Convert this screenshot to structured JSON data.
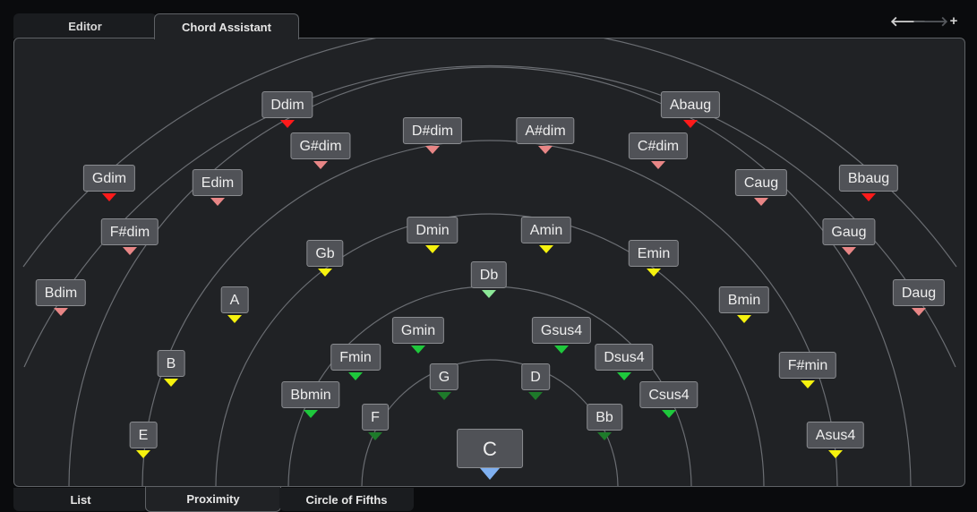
{
  "tabs_top": [
    {
      "label": "Editor",
      "active": false
    },
    {
      "label": "Chord Assistant",
      "active": true
    }
  ],
  "nav": {
    "back": "🡐",
    "forward": "🡒",
    "add": "+"
  },
  "colors": {
    "red": "#ff1a1a",
    "pink": "#e88686",
    "yellow": "#f6f20e",
    "green": "#1ec83c",
    "dark_green": "#1e7a2a",
    "light_green": "#8ce898",
    "blue": "#7fb0f0"
  },
  "chords": [
    {
      "label": "Ddim",
      "marker": "red"
    },
    {
      "label": "Abaug",
      "marker": "red"
    },
    {
      "label": "G#dim",
      "marker": "pink"
    },
    {
      "label": "D#dim",
      "marker": "pink"
    },
    {
      "label": "A#dim",
      "marker": "pink"
    },
    {
      "label": "C#dim",
      "marker": "pink"
    },
    {
      "label": "Gdim",
      "marker": "red"
    },
    {
      "label": "Edim",
      "marker": "pink"
    },
    {
      "label": "Caug",
      "marker": "pink"
    },
    {
      "label": "Bbaug",
      "marker": "red"
    },
    {
      "label": "F#dim",
      "marker": "pink"
    },
    {
      "label": "Gaug",
      "marker": "pink"
    },
    {
      "label": "Dmin",
      "marker": "yellow"
    },
    {
      "label": "Amin",
      "marker": "yellow"
    },
    {
      "label": "Gb",
      "marker": "yellow"
    },
    {
      "label": "Emin",
      "marker": "yellow"
    },
    {
      "label": "Db",
      "marker": "light_green"
    },
    {
      "label": "Bdim",
      "marker": "pink"
    },
    {
      "label": "Daug",
      "marker": "pink"
    },
    {
      "label": "A",
      "marker": "yellow"
    },
    {
      "label": "Bmin",
      "marker": "yellow"
    },
    {
      "label": "Gmin",
      "marker": "green"
    },
    {
      "label": "Gsus4",
      "marker": "green"
    },
    {
      "label": "Fmin",
      "marker": "green"
    },
    {
      "label": "Dsus4",
      "marker": "green"
    },
    {
      "label": "B",
      "marker": "yellow"
    },
    {
      "label": "F#min",
      "marker": "yellow"
    },
    {
      "label": "G",
      "marker": "dark_green"
    },
    {
      "label": "D",
      "marker": "dark_green"
    },
    {
      "label": "Bbmin",
      "marker": "green"
    },
    {
      "label": "Csus4",
      "marker": "green"
    },
    {
      "label": "F",
      "marker": "dark_green"
    },
    {
      "label": "Bb",
      "marker": "dark_green"
    },
    {
      "label": "E",
      "marker": "yellow"
    },
    {
      "label": "Asus4",
      "marker": "yellow"
    }
  ],
  "root_chord": {
    "label": "C",
    "marker": "blue"
  },
  "tabs_bottom": [
    {
      "label": "List",
      "active": false
    },
    {
      "label": "Proximity",
      "active": true
    },
    {
      "label": "Circle of Fifths",
      "active": false
    }
  ]
}
